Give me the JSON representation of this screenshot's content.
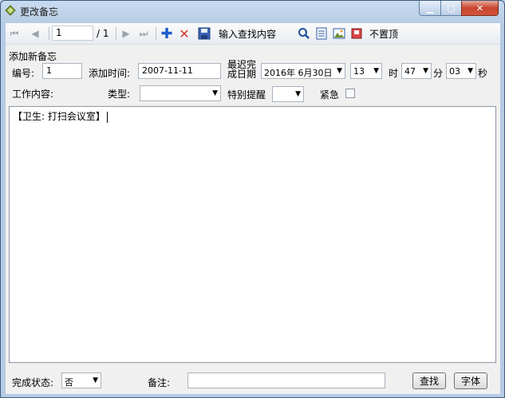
{
  "window": {
    "title": "更改备忘"
  },
  "toolbar": {
    "record_value": "1",
    "record_total": "/ 1",
    "search_placeholder": "输入查找内容",
    "pin_label": "不置顶"
  },
  "form": {
    "section_title": "添加新备忘",
    "id_label": "编号:",
    "id_value": "1",
    "added_label": "添加时间:",
    "added_value": "2007-11-11",
    "deadline_label_line1": "最迟完",
    "deadline_label_line2": "成日期",
    "deadline_date": "2016年 6月30日",
    "hour_value": "13",
    "hour_unit": "时",
    "minute_value": "47",
    "minute_unit": "分",
    "second_value": "03",
    "second_unit": "秒",
    "work_label": "工作内容:",
    "type_label": "类型:",
    "type_value": "",
    "reminder_label": "特别提醒",
    "reminder_value": "",
    "urgent_label": "紧急",
    "content_text": "【卫生: 打扫会议室】"
  },
  "footer": {
    "status_label": "完成状态:",
    "status_value": "否",
    "note_label": "备注:",
    "note_value": "",
    "find_button": "查找",
    "font_button": "字体"
  }
}
